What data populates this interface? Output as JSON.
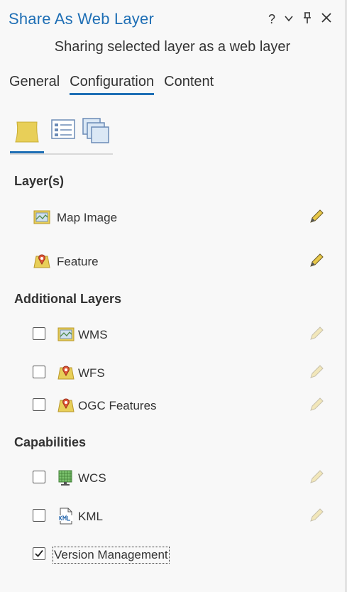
{
  "window": {
    "title": "Share As Web Layer",
    "help": "?"
  },
  "subtitle": "Sharing selected layer as a web layer",
  "tabs": [
    {
      "label": "General"
    },
    {
      "label": "Configuration"
    },
    {
      "label": "Content"
    }
  ],
  "sections": {
    "layers": "Layer(s)",
    "additional": "Additional Layers",
    "capabilities": "Capabilities"
  },
  "layers": [
    {
      "label": "Map Image"
    },
    {
      "label": "Feature"
    }
  ],
  "additional_layers": [
    {
      "label": "WMS",
      "checked": false
    },
    {
      "label": "WFS",
      "checked": false
    },
    {
      "label": "OGC Features",
      "checked": false
    }
  ],
  "capabilities": [
    {
      "label": "WCS",
      "checked": false
    },
    {
      "label": "KML",
      "checked": false
    },
    {
      "label": "Version Management",
      "checked": true
    }
  ],
  "colors": {
    "accent": "#1f6fb5",
    "pencil": "#e8c84a"
  }
}
